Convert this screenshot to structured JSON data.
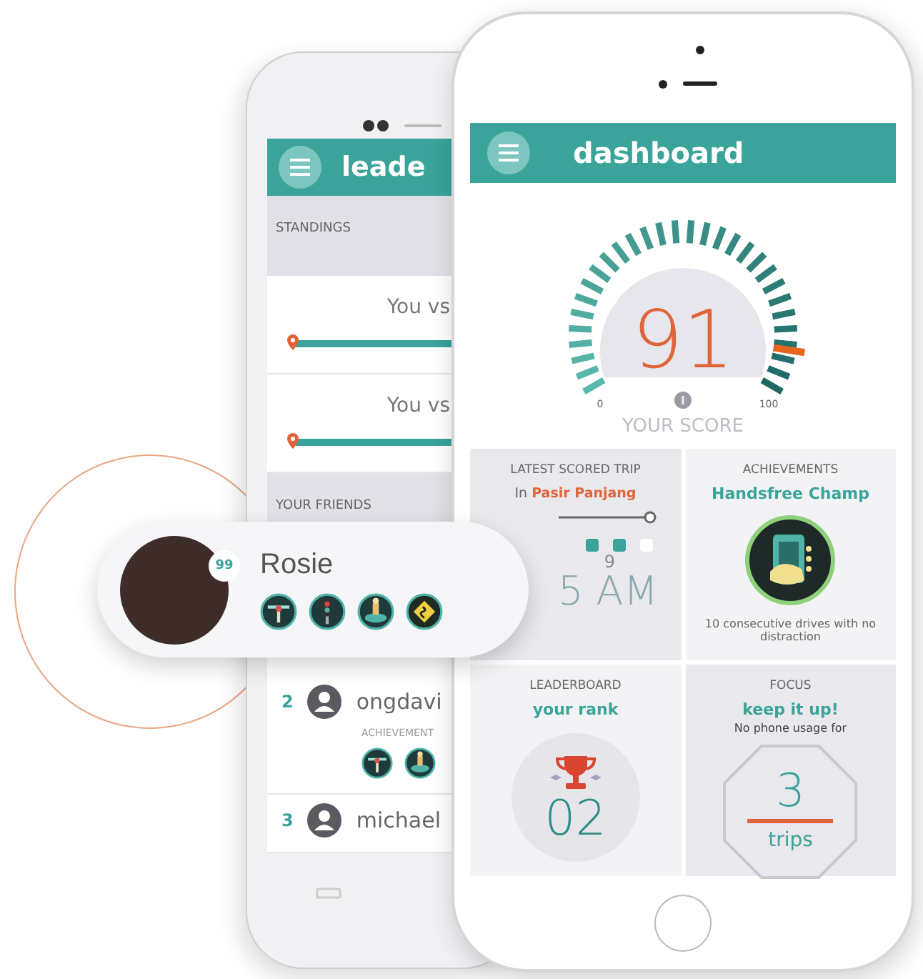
{
  "back_phone": {
    "title": "leade",
    "standings_label": "STANDINGS",
    "matchups": [
      {
        "label": "You vs"
      },
      {
        "label": "You vs"
      }
    ],
    "friends_label": "YOUR FRIENDS",
    "friends": [
      {
        "rank": "2",
        "name": "ongdavi",
        "achievements_label": "ACHIEVEMENT",
        "badges": [
          {
            "kind": "road"
          },
          {
            "kind": "car"
          }
        ]
      },
      {
        "rank": "3",
        "name": "michael"
      }
    ]
  },
  "popup": {
    "name": "Rosie",
    "score": "99",
    "badges": [
      {
        "kind": "road"
      },
      {
        "kind": "signal"
      },
      {
        "kind": "car"
      },
      {
        "kind": "sign"
      }
    ]
  },
  "front_phone": {
    "title": "dashboard",
    "score": {
      "value": "91",
      "min": "0",
      "max": "100",
      "label": "YOUR SCORE",
      "level": 0.91
    },
    "cards": [
      {
        "kind": "trip",
        "heading": "LATEST SCORED TRIP",
        "subtitle": "In **Pasir Panjang**",
        "dots": [
          {
            "on": true
          },
          {
            "on": true
          },
          {
            "on": false
          }
        ],
        "date": "9",
        "time": "5 AM"
      },
      {
        "kind": "achievement",
        "heading": "ACHIEVEMENTS",
        "title": "Handsfree Champ",
        "description": "10 consecutive drives with no distraction"
      },
      {
        "kind": "rank",
        "heading": "LEADERBOARD",
        "title": "your rank",
        "rank": "02"
      },
      {
        "kind": "focus",
        "heading": "FOCUS",
        "title": "keep it up!",
        "description": "No phone usage for",
        "count": "3",
        "unit": "trips"
      }
    ]
  }
}
